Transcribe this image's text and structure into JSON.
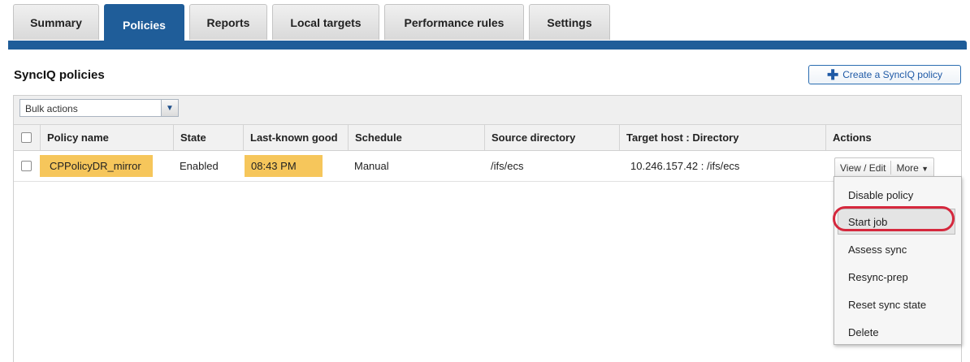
{
  "tabs": [
    {
      "label": "Summary"
    },
    {
      "label": "Policies",
      "active": true
    },
    {
      "label": "Reports"
    },
    {
      "label": "Local targets"
    },
    {
      "label": "Performance rules"
    },
    {
      "label": "Settings"
    }
  ],
  "section_title": "SyncIQ policies",
  "create_button": "Create a SyncIQ policy",
  "bulk_actions": {
    "selected": "Bulk actions"
  },
  "columns": [
    "Policy name",
    "State",
    "Last-known good",
    "Schedule",
    "Source directory",
    "Target host : Directory",
    "Actions"
  ],
  "rows": [
    {
      "policy_name": "CPPolicyDR_mirror",
      "state": "Enabled",
      "last_known_good": "08:43 PM",
      "schedule": "Manual",
      "source_directory": "/ifs/ecs",
      "target": "10.246.157.42 : /ifs/ecs"
    }
  ],
  "row_actions": {
    "view_edit": "View / Edit",
    "more": "More"
  },
  "more_menu": [
    "Disable policy",
    "Start job",
    "Assess sync",
    "Resync-prep",
    "Reset sync state",
    "Delete"
  ],
  "colors": {
    "brand": "#1f5d99",
    "highlight": "#f6c65b",
    "annotation": "#d5283d"
  }
}
